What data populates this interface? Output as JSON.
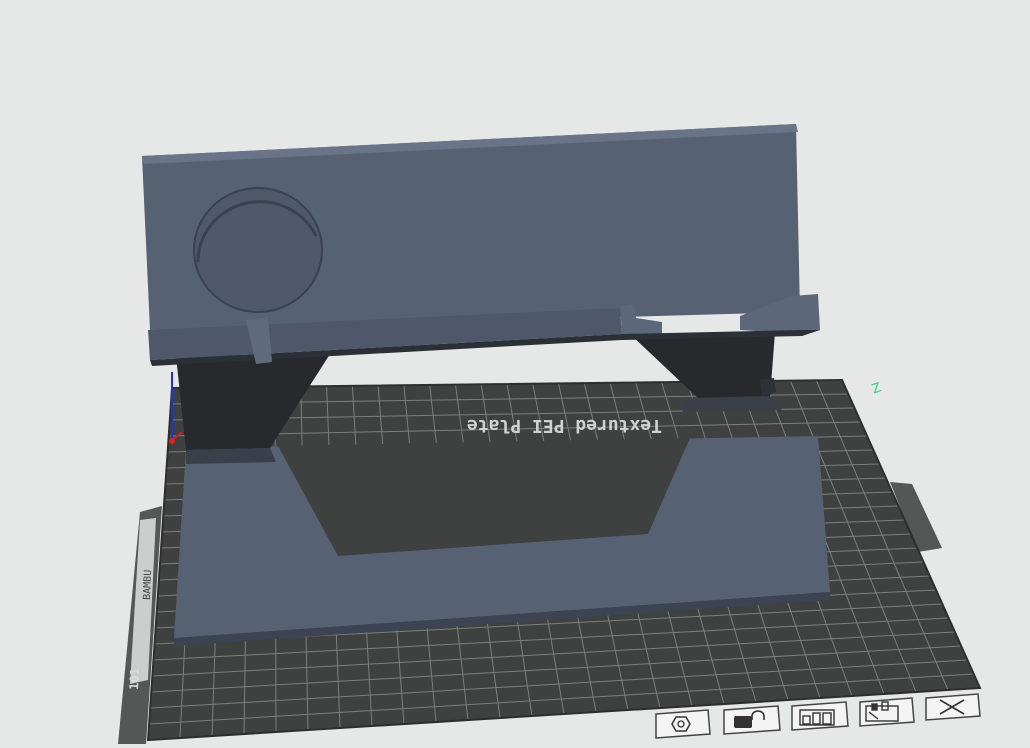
{
  "viewport": {
    "background_color": "#e6e7e7",
    "model_color": "#566174",
    "model_dark_color": "#27292c",
    "plate_color": "#3f4040",
    "grid_color": "#8a8a8a"
  },
  "plate": {
    "label": "Textured PEI Plate",
    "side_label": "BAMBU",
    "corner_label": "101"
  },
  "axis_marker": {
    "label": "Z",
    "color": "#2fd084"
  },
  "plate_toolbar": {
    "buttons": [
      {
        "name": "arrange",
        "icon": "hexagon-nut-icon"
      },
      {
        "name": "lock",
        "icon": "lock-icon"
      },
      {
        "name": "layout",
        "icon": "layout-icon"
      },
      {
        "name": "settings",
        "icon": "settings-icon"
      },
      {
        "name": "close",
        "icon": "close-icon"
      }
    ]
  }
}
